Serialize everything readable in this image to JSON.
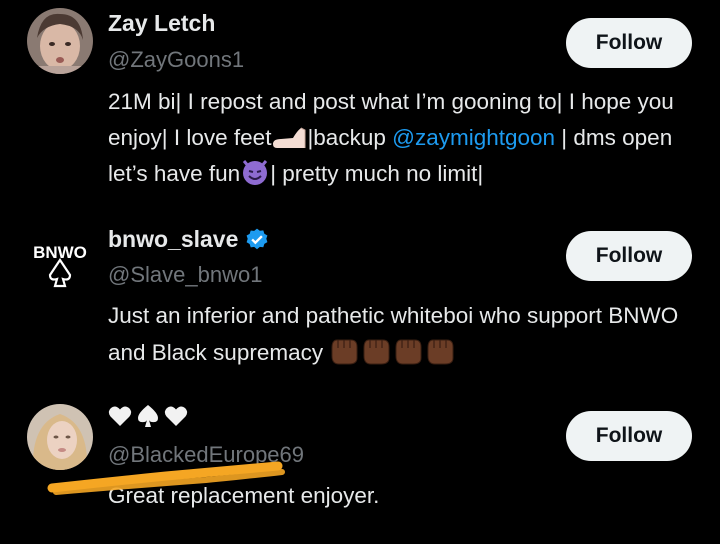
{
  "accounts": [
    {
      "display_name": "Zay Letch",
      "handle": "@ZayGoons1",
      "follow_label": "Follow",
      "bio_parts": [
        "21M bi| I repost and post what I’m gooning to| I hope you enjoy| I love feet",
        "|backup ",
        "@zaymightgoon",
        " | dms open let’s have fun",
        "| pretty much no limit|"
      ],
      "bio_emojis": [
        "foot-emoji",
        "smiling-imp-emoji"
      ],
      "avatar": "user-photo-avatar"
    },
    {
      "display_name": "bnwo_slave",
      "handle": "@Slave_bnwo1",
      "follow_label": "Follow",
      "verified": true,
      "bio_text": "Just an inferior and pathetic whiteboi who support BNWO and Black supremacy",
      "bio_emojis": [
        "raised-fist-emoji",
        "raised-fist-emoji",
        "raised-fist-emoji",
        "raised-fist-emoji"
      ],
      "avatar_text": "BNWO",
      "avatar": "bnwo-logo-avatar"
    },
    {
      "display_name_icons": [
        "white-heart-icon",
        "spade-icon",
        "white-heart-icon"
      ],
      "handle": "@BlackedEurope69",
      "follow_label": "Follow",
      "bio_text": "Great replacement enjoyer.",
      "avatar": "user-photo-avatar"
    }
  ],
  "colors": {
    "background": "#000000",
    "text_primary": "#e7e9ea",
    "text_secondary": "#71767b",
    "link": "#1d9bf0",
    "button_bg": "#eff3f4",
    "button_text": "#0f1419",
    "verified": "#1d9bf0",
    "highlighter": "#f5a623"
  }
}
